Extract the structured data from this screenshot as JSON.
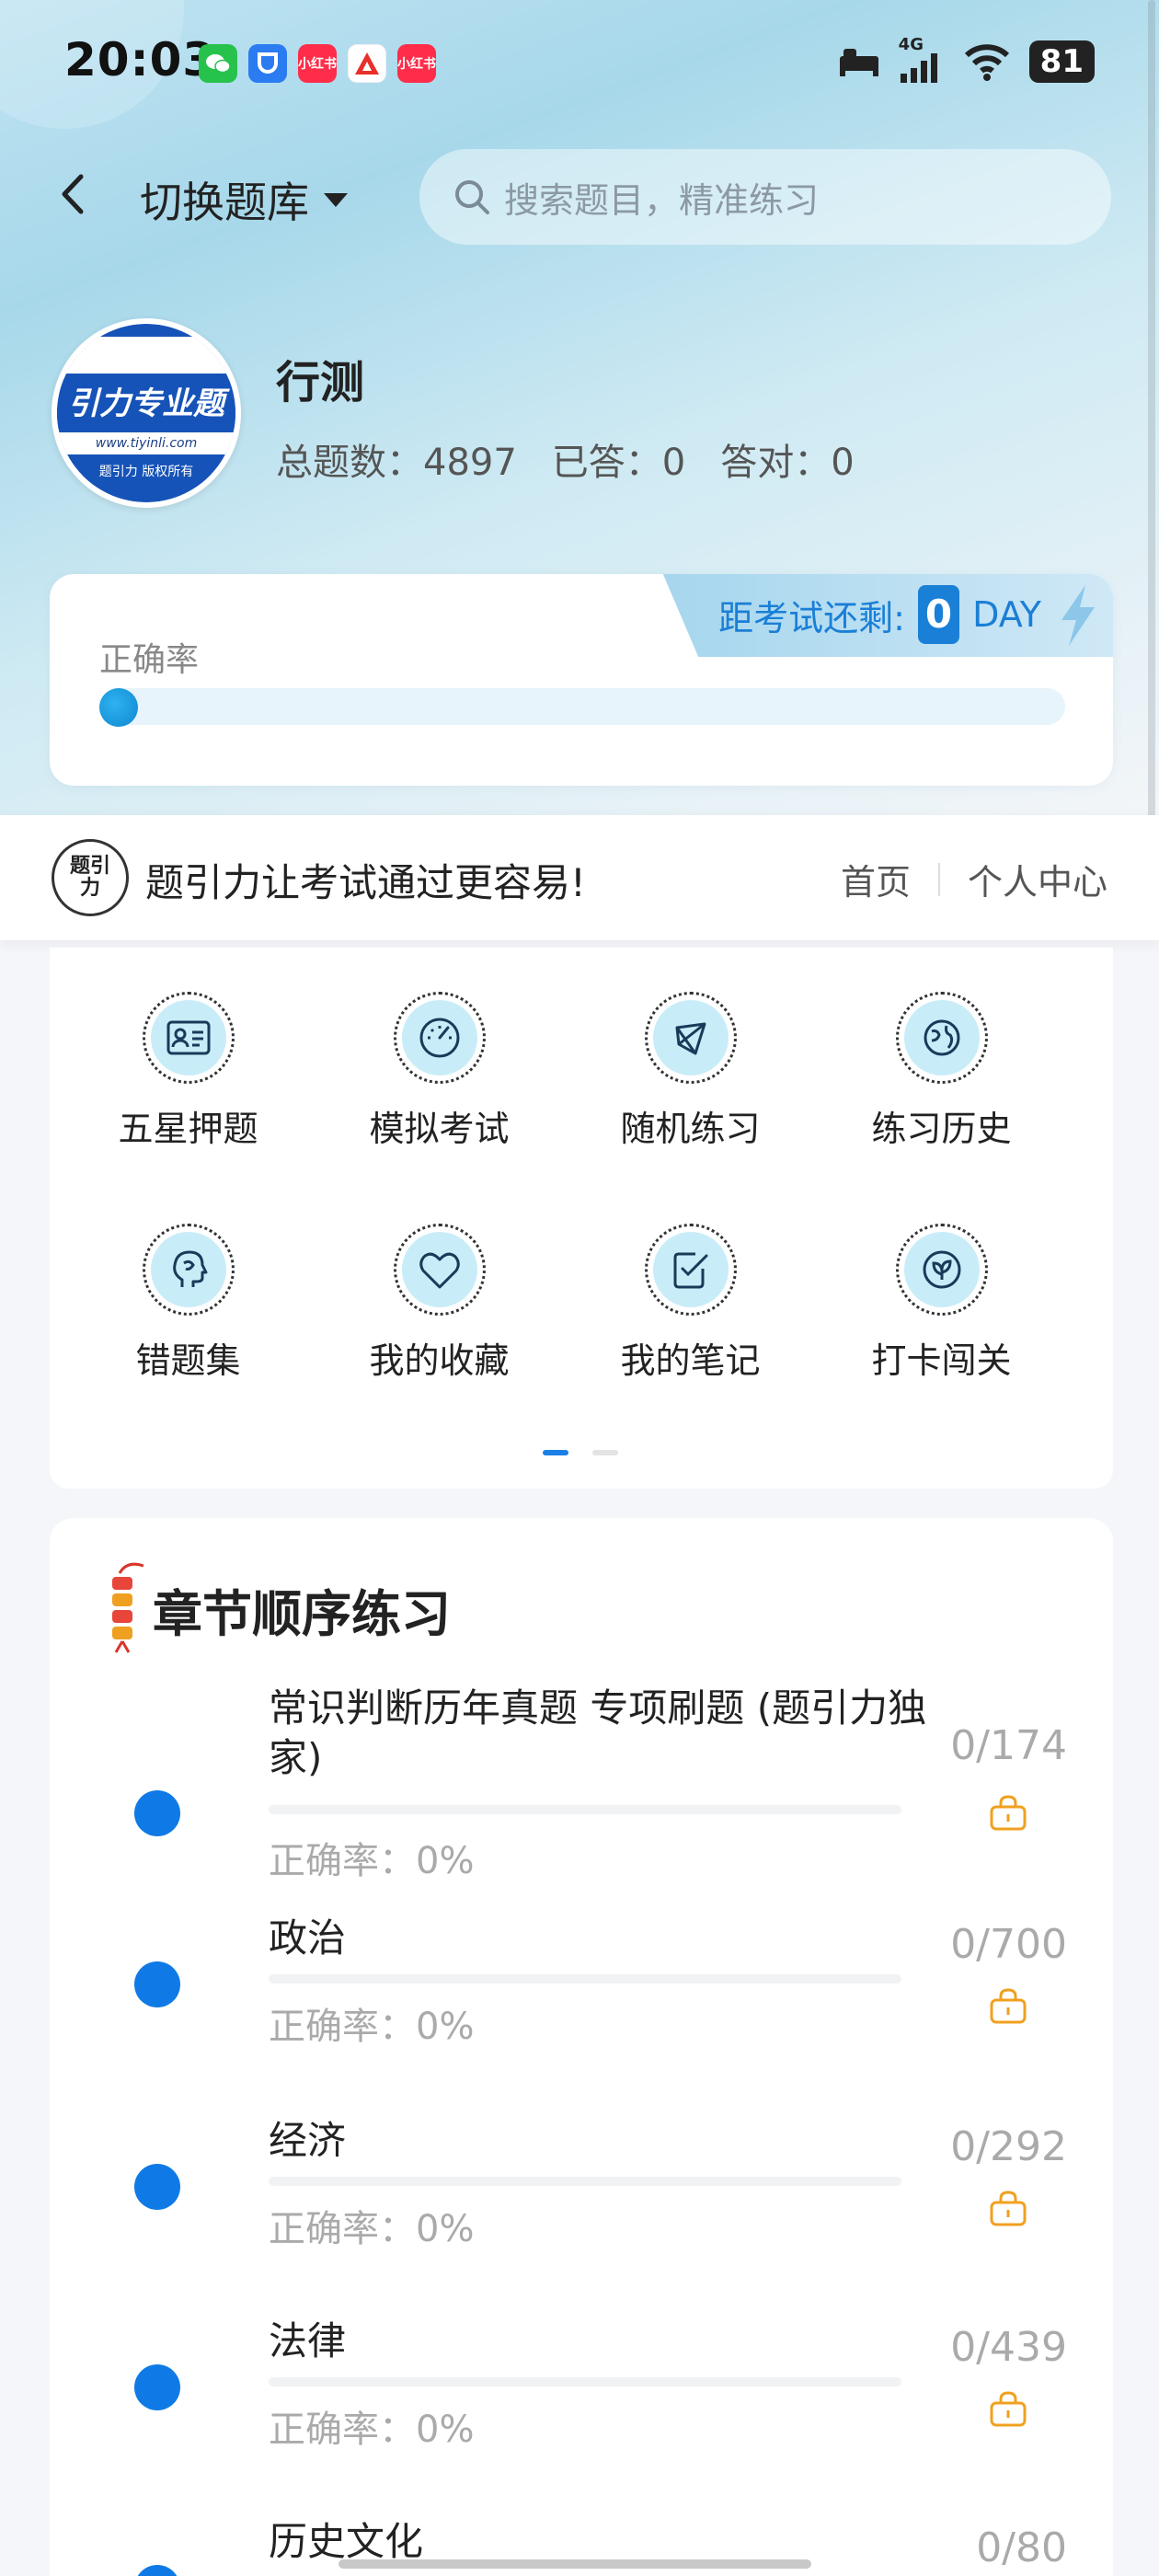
{
  "status_bar": {
    "time": "20:03",
    "network": "4G",
    "battery": "81",
    "app_icons": [
      "wechat-icon",
      "shield-app-icon",
      "xiaohongshu-icon",
      "app-a-icon",
      "xiaohongshu-icon"
    ],
    "app_icon_labels": [
      "",
      "",
      "小红书",
      "",
      "小红书"
    ]
  },
  "header": {
    "title": "切换题库",
    "search_placeholder": "搜索题目，精准练习"
  },
  "bank": {
    "logo_text": "引力专业题",
    "logo_url": "www.tiyinli.com",
    "logo_copyright": "题引力 版权所有",
    "name": "行测",
    "total_label": "总题数：",
    "total_value": "4897",
    "answered_label": "已答：",
    "answered_value": "0",
    "correct_label": "答对：",
    "correct_value": "0"
  },
  "accuracy": {
    "label": "正确率",
    "progress": 0,
    "countdown_label": "距考试还剩:",
    "countdown_value": "0",
    "countdown_unit": "DAY"
  },
  "slogan": {
    "logo_text": "题引力",
    "text": "题引力让考试通过更容易!",
    "nav_home": "首页",
    "nav_profile": "个人中心"
  },
  "grid": {
    "items": [
      {
        "label": "五星押题",
        "icon": "id-card-icon"
      },
      {
        "label": "模拟考试",
        "icon": "gauge-icon"
      },
      {
        "label": "随机练习",
        "icon": "network-icon"
      },
      {
        "label": "练习历史",
        "icon": "globe-icon"
      },
      {
        "label": "错题集",
        "icon": "head-profile-icon"
      },
      {
        "label": "我的收藏",
        "icon": "heart-icon"
      },
      {
        "label": "我的笔记",
        "icon": "note-check-icon"
      },
      {
        "label": "打卡闯关",
        "icon": "leaf-badge-icon"
      }
    ],
    "page_indicator": {
      "current": 1,
      "total": 2
    }
  },
  "chapters": {
    "title": "章节顺序练习",
    "accuracy_prefix": "正确率：",
    "items": [
      {
        "name": "常识判断历年真题 专项刷题 (题引力独家)",
        "accuracy": "0%",
        "count": "0/174",
        "locked": true
      },
      {
        "name": "政治",
        "accuracy": "0%",
        "count": "0/700",
        "locked": true
      },
      {
        "name": "经济",
        "accuracy": "0%",
        "count": "0/292",
        "locked": true
      },
      {
        "name": "法律",
        "accuracy": "0%",
        "count": "0/439",
        "locked": true
      },
      {
        "name": "历史文化",
        "accuracy": "",
        "count": "0/80",
        "locked": true
      }
    ]
  },
  "colors": {
    "accent": "#0f7ae5",
    "lock": "#f0a020",
    "progress_bg": "#e7f4fb"
  }
}
